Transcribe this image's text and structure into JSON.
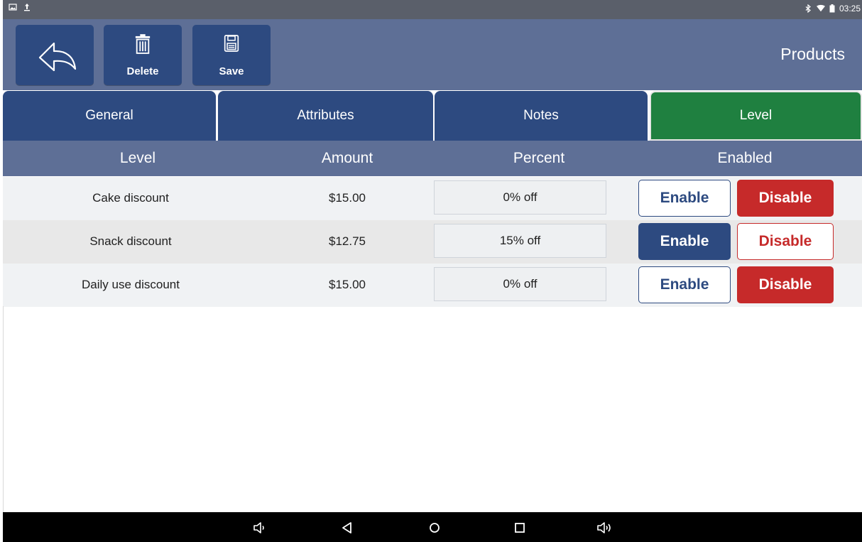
{
  "status_bar": {
    "time": "03:25",
    "left_icons": [
      "image-icon",
      "upload-icon"
    ],
    "right_icons": [
      "bluetooth-icon",
      "wifi-icon",
      "battery-icon"
    ]
  },
  "toolbar": {
    "back_icon": "back-arrow-icon",
    "delete_label": "Delete",
    "save_label": "Save",
    "title": "Products"
  },
  "tabs": [
    {
      "label": "General",
      "active": false
    },
    {
      "label": "Attributes",
      "active": false
    },
    {
      "label": "Notes",
      "active": false
    },
    {
      "label": "Level",
      "active": true
    }
  ],
  "table": {
    "headers": [
      "Level",
      "Amount",
      "Percent",
      "Enabled"
    ],
    "enable_label": "Enable",
    "disable_label": "Disable",
    "rows": [
      {
        "level": "Cake discount",
        "amount": "$15.00",
        "percent": "0% off",
        "enabled": false
      },
      {
        "level": "Snack discount",
        "amount": "$12.75",
        "percent": "15% off",
        "enabled": true
      },
      {
        "level": "Daily use discount",
        "amount": "$15.00",
        "percent": "0% off",
        "enabled": false
      }
    ]
  },
  "colors": {
    "primary": "#2d4a80",
    "header": "#5e6f96",
    "active_tab": "#1f8040",
    "danger": "#c62a2a"
  },
  "nav_bar": [
    "volume-down-icon",
    "back-icon",
    "home-icon",
    "recents-icon",
    "volume-up-icon"
  ]
}
